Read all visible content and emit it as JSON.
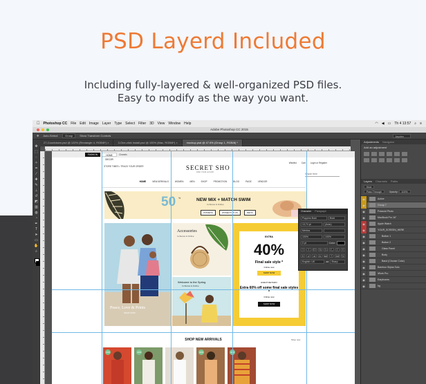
{
  "headline": "PSD Layerd Included",
  "description": {
    "line1": "Including fully-layered & well-organized PSD files.",
    "line2": "Easy to modify as the way you want."
  },
  "mac_menubar": {
    "apple_icon": "apple-icon",
    "items": [
      "Photoshop CC",
      "File",
      "Edit",
      "Image",
      "Layer",
      "Type",
      "Select",
      "Filter",
      "3D",
      "View",
      "Window",
      "Help"
    ],
    "clock": "Th 4 13:57"
  },
  "app": {
    "window_title": "Adobe Photoshop CC 2015",
    "options_bar": [
      "Auto-Select:",
      "Group",
      "Show Transform Controls"
    ],
    "search_label": "Jayden",
    "tabs": [
      {
        "label": "27-Countdown.psd @ 122% (Rectangle 4, RGB/8*) ×",
        "active": false
      },
      {
        "label": "3-One-click install.psd @ 100% (Mac, RGB/8*) ×",
        "active": false
      },
      {
        "label": "mockup.psd @ 47.6% (Group 1, RGB/8) *",
        "active": true
      }
    ]
  },
  "colors": {
    "accent": "#ee7a35",
    "dark_band": "#3a3a3c",
    "ps_panel": "#484848",
    "yellow": "#f6cc35"
  },
  "site": {
    "top_pills": [
      "FASHION",
      "HOME DECOR",
      "Chanels"
    ],
    "lang_links": "STORE TIMES • TRACK YOUR ORDER",
    "logo": "SECRET SHO",
    "logo_tagline": "FIND YOUR LUXURY",
    "top_right": [
      "Wishlist",
      "Cart",
      "Login or Register"
    ],
    "search_placeholder": "Search Here",
    "nav": [
      "HOME",
      "NEW ARRIVALS",
      "WOMEN",
      "MEN",
      "SHOP",
      "PROMOTION",
      "BLOG",
      "PAGE",
      "VENDOR"
    ],
    "banner": {
      "number": "50",
      "percent_label": "%",
      "title": "NEW MIX + MATCH SWIM",
      "subtitle": "In-Stores & Online",
      "buttons": [
        "WOMENS",
        "WOMEN'S PLUS",
        "MENS"
      ]
    },
    "promo_a": {
      "caption": "Peace, Love & Prints",
      "cta": "SHOP NOW"
    },
    "promo_b": {
      "title": "Accessories",
      "subtitle": "In-Stores & Online"
    },
    "promo_c": {
      "title": "Welcome to the Spring",
      "subtitle": "In-Stores & Online"
    },
    "promo_d": {
      "extra": "EXTRA",
      "big": "40%",
      "sale": "Final sale style *",
      "online": "Online now",
      "button1": "SHOP NOW",
      "event": "EVENT RETURN",
      "extra60": "Extra 60% off some final sale styles *",
      "online2": "Online now",
      "button2": "SHOP NOW"
    },
    "arrivals_title": "SHOP NEW ARRIVALS",
    "shop_all": "Shop now",
    "thumb_badge": "-20%"
  },
  "character_panel": {
    "title": "Character",
    "tab2": "Paragraph",
    "font": "Poppins Bold",
    "weight": "Bold",
    "size": "13,74 pt",
    "leading": "(Auto)",
    "tracking": "Metrics",
    "scale_v": "100%",
    "scale_h": "100%",
    "baseline": "0 pt",
    "color_label": "Color:",
    "lang": "English: UK",
    "aa": "aa",
    "sharp": "Sharp"
  },
  "right_panel": {
    "adj_tabs": [
      "Adjustments",
      "Navigator"
    ],
    "adj_title": "Add an adjustment",
    "layers_tabs": [
      "Layers",
      "Channels",
      "Paths"
    ],
    "kind": "Kind",
    "blend": "Pass Through",
    "opacity_label": "Opacity:",
    "opacity": "100%",
    "lock_label": "Lock:",
    "fill_label": "Fill:",
    "fill": "100%",
    "layers": [
      {
        "name": "Active",
        "eye": "y"
      },
      {
        "name": "Group 7",
        "eye": "y"
      },
      {
        "name": "Polaroid Photo",
        "eye": ""
      },
      {
        "name": "MacBook Pro 16\"",
        "eye": ""
      },
      {
        "name": "Apple Watch",
        "eye": "r"
      },
      {
        "name": "YOUR_SCREEN_HERE",
        "eye": "r"
      },
      {
        "name": "Button 1",
        "eye": ""
      },
      {
        "name": "Button 2",
        "eye": ""
      },
      {
        "name": "Glass Panel",
        "eye": ""
      },
      {
        "name": "Body",
        "eye": ""
      },
      {
        "name": "Band (Choose Color)",
        "eye": ""
      },
      {
        "name": "Bamboo Stylus Solo",
        "eye": ""
      },
      {
        "name": "iWork Pro",
        "eye": ""
      },
      {
        "name": "Earphones",
        "eye": ""
      },
      {
        "name": "bg",
        "eye": ""
      }
    ]
  }
}
